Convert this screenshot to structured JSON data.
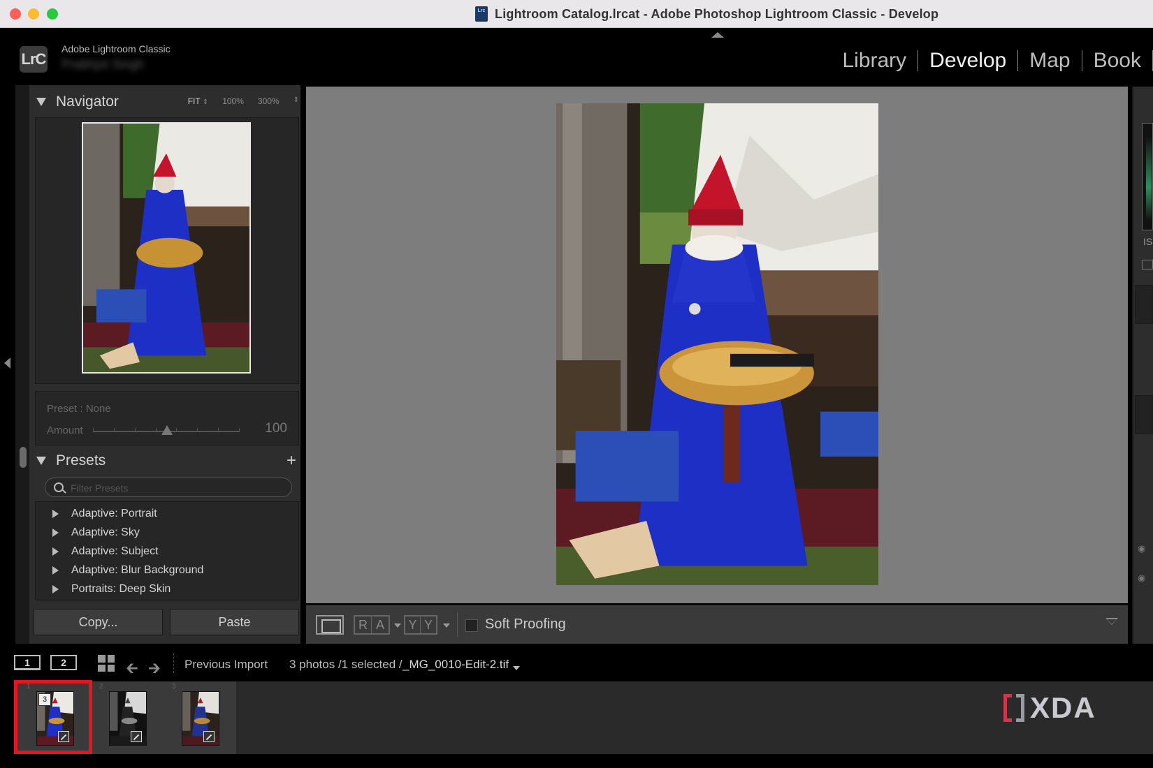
{
  "window": {
    "title": "Lightroom Catalog.lrcat - Adobe Photoshop Lightroom Classic - Develop",
    "doc_icon": "Lrc"
  },
  "identity": {
    "logo": "LrC",
    "app_name": "Adobe Lightroom Classic",
    "user_name": "Prabhjot Singh"
  },
  "modules": [
    {
      "label": "Library",
      "active": false
    },
    {
      "label": "Develop",
      "active": true
    },
    {
      "label": "Map",
      "active": false
    },
    {
      "label": "Book",
      "active": false
    }
  ],
  "navigator": {
    "title": "Navigator",
    "zoom_fit": "FIT",
    "zoom_100": "100%",
    "zoom_300": "300%"
  },
  "preset_amount": {
    "preset_label": "Preset : None",
    "amount_label": "Amount",
    "amount_value": "100"
  },
  "presets": {
    "title": "Presets",
    "add_icon": "+",
    "filter_placeholder": "Filter Presets",
    "items": [
      "Adaptive: Portrait",
      "Adaptive: Sky",
      "Adaptive: Subject",
      "Adaptive: Blur Background",
      "Portraits: Deep Skin"
    ]
  },
  "buttons": {
    "copy": "Copy...",
    "paste": "Paste"
  },
  "toolbar": {
    "ra_left": "R",
    "ra_right": "A",
    "yy_left": "Y",
    "yy_right": "Y",
    "soft_proofing": "Soft Proofing"
  },
  "right_panel": {
    "is_label": "IS"
  },
  "filmstrip_bar": {
    "screen_1": "1",
    "screen_2": "2",
    "source": "Previous Import",
    "count": "3 photos /1 selected /",
    "file": "_MG_0010-Edit-2.tif"
  },
  "filmstrip": {
    "cells": [
      {
        "index": "1",
        "stack": "3",
        "selected": true
      },
      {
        "index": "2",
        "selected": false
      },
      {
        "index": "3",
        "selected": false
      }
    ]
  },
  "watermark": {
    "text": "XDA"
  },
  "colors": {
    "selection": "#e8151e",
    "dress": "#1d2fc4",
    "hat": "#c4142c"
  }
}
